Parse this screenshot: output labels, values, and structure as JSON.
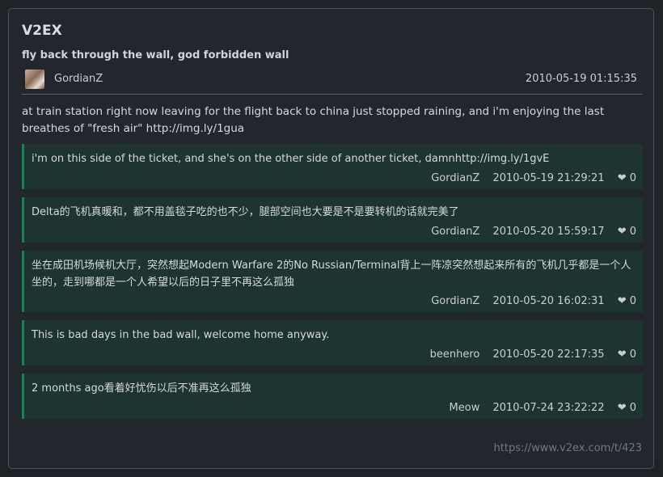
{
  "site": {
    "name": "V2EX"
  },
  "topic": {
    "title": "fly back through the wall, god forbidden wall",
    "author": "GordianZ",
    "created": "2010-05-19 01:15:35",
    "content": "at train station right now leaving for the flight back to china just stopped raining, and i'm enjoying the last breathes of \"fresh air\" http://img.ly/1gua"
  },
  "replies": [
    {
      "content": "i'm on this side of the ticket, and she's on the other side of another ticket, damnhttp://img.ly/1gvE",
      "author": "GordianZ",
      "time": "2010-05-19 21:29:21",
      "likes": "❤ 0"
    },
    {
      "content": "Delta的飞机真暖和，都不用盖毯子吃的也不少，腿部空间也大要是不是要转机的话就完美了",
      "author": "GordianZ",
      "time": "2010-05-20 15:59:17",
      "likes": "❤ 0"
    },
    {
      "content": "坐在成田机场候机大厅，突然想起Modern Warfare 2的No Russian/Terminal背上一阵凉突然想起来所有的飞机几乎都是一个人坐的，走到哪都是一个人希望以后的日子里不再这么孤独",
      "author": "GordianZ",
      "time": "2010-05-20 16:02:31",
      "likes": "❤ 0"
    },
    {
      "content": "This is bad days in the bad wall, welcome home anyway.",
      "author": "beenhero",
      "time": "2010-05-20 22:17:35",
      "likes": "❤ 0"
    },
    {
      "content": "2 months ago看着好忧伤以后不准再这么孤独",
      "author": "Meow",
      "time": "2010-07-24 23:22:22",
      "likes": "❤ 0"
    }
  ],
  "footer": {
    "link": "https://www.v2ex.com/t/423"
  },
  "colors": {
    "accent": "#188351",
    "reply_bg": "#1e3431",
    "card_bg": "#22272e",
    "page_bg": "#1f2327"
  }
}
